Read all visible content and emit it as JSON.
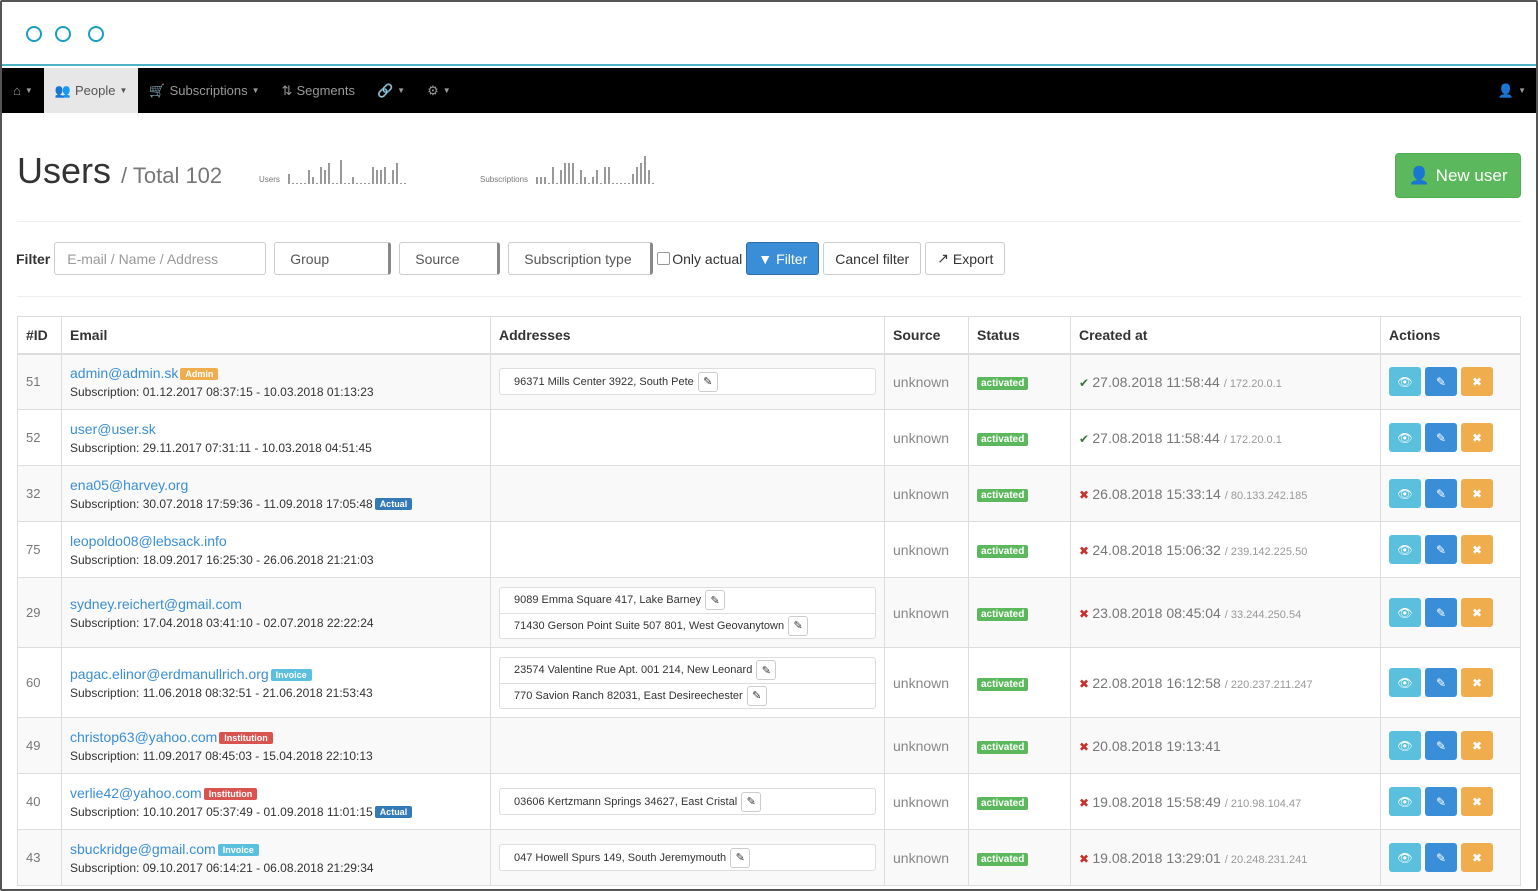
{
  "colors": {
    "accent": "#3a8ed8",
    "success": "#5cb85c",
    "info": "#5bc0de",
    "warning": "#f0ad4e",
    "danger": "#d9534f"
  },
  "nav": {
    "items": [
      {
        "icon": "home-icon",
        "label": ""
      },
      {
        "icon": "people-icon",
        "label": "People",
        "active": true
      },
      {
        "icon": "cart-icon",
        "label": "Subscriptions"
      },
      {
        "icon": "segments-icon",
        "label": "Segments"
      },
      {
        "icon": "link-icon",
        "label": ""
      },
      {
        "icon": "gear-icon",
        "label": ""
      }
    ],
    "user_icon": "user-icon"
  },
  "header": {
    "title": "Users",
    "subtitle": "/ Total 102",
    "new_user": "New user"
  },
  "sparklines": [
    {
      "label": "Users",
      "values": [
        3,
        0,
        0,
        0,
        0,
        4,
        2,
        0,
        5,
        4,
        6,
        0,
        0,
        7,
        0,
        0,
        2,
        0,
        0,
        0,
        0,
        5,
        4,
        4,
        5,
        0,
        4,
        6,
        0,
        0
      ]
    },
    {
      "label": "Subscriptions",
      "values": [
        2,
        2,
        2,
        0,
        5,
        0,
        4,
        6,
        6,
        6,
        0,
        4,
        2,
        0,
        2,
        4,
        0,
        5,
        5,
        0,
        0,
        0,
        0,
        0,
        3,
        5,
        6,
        8,
        4,
        0
      ]
    }
  ],
  "filter": {
    "label": "Filter",
    "search_placeholder": "E-mail / Name / Address",
    "group": "Group",
    "source": "Source",
    "subscription_type": "Subscription type",
    "only_actual": "Only actual",
    "filter_btn": "Filter",
    "cancel_btn": "Cancel filter",
    "export_btn": "Export"
  },
  "table": {
    "headers": [
      "#ID",
      "Email",
      "Addresses",
      "Source",
      "Status",
      "Created at",
      "Actions"
    ],
    "rows": [
      {
        "id": "51",
        "email": "admin@admin.sk",
        "labels": [
          {
            "text": "Admin",
            "color": "#f0ad4e"
          }
        ],
        "sub": "Subscription: 01.12.2017 08:37:15 - 10.03.2018 01:13:23",
        "sub_label": null,
        "addresses": [
          "96371 Mills Center 3922, South Pete"
        ],
        "source": "unknown",
        "status": "activated",
        "ok": true,
        "created": "27.08.2018 11:58:44",
        "ip": "/ 172.20.0.1"
      },
      {
        "id": "52",
        "email": "user@user.sk",
        "labels": [],
        "sub": "Subscription: 29.11.2017 07:31:11 - 10.03.2018 04:51:45",
        "sub_label": null,
        "addresses": [],
        "source": "unknown",
        "status": "activated",
        "ok": true,
        "created": "27.08.2018 11:58:44",
        "ip": "/ 172.20.0.1"
      },
      {
        "id": "32",
        "email": "ena05@harvey.org",
        "labels": [],
        "sub": "Subscription: 30.07.2018 17:59:36 - 11.09.2018 17:05:48",
        "sub_label": "Actual",
        "addresses": [],
        "source": "unknown",
        "status": "activated",
        "ok": false,
        "created": "26.08.2018 15:33:14",
        "ip": "/ 80.133.242.185"
      },
      {
        "id": "75",
        "email": "leopoldo08@lebsack.info",
        "labels": [],
        "sub": "Subscription: 18.09.2017 16:25:30 - 26.06.2018 21:21:03",
        "sub_label": null,
        "addresses": [],
        "source": "unknown",
        "status": "activated",
        "ok": false,
        "created": "24.08.2018 15:06:32",
        "ip": "/ 239.142.225.50"
      },
      {
        "id": "29",
        "email": "sydney.reichert@gmail.com",
        "labels": [],
        "sub": "Subscription: 17.04.2018 03:41:10 - 02.07.2018 22:22:24",
        "sub_label": null,
        "addresses": [
          "9089 Emma Square 417, Lake Barney",
          "71430 Gerson Point Suite 507 801, West Geovanytown"
        ],
        "source": "unknown",
        "status": "activated",
        "ok": false,
        "created": "23.08.2018 08:45:04",
        "ip": "/ 33.244.250.54"
      },
      {
        "id": "60",
        "email": "pagac.elinor@erdmanullrich.org",
        "labels": [
          {
            "text": "Invoice",
            "color": "#5bc0de"
          }
        ],
        "sub": "Subscription: 11.06.2018 08:32:51 - 21.06.2018 21:53:43",
        "sub_label": null,
        "addresses": [
          "23574 Valentine Rue Apt. 001 214, New Leonard",
          "770 Savion Ranch 82031, East Desireechester"
        ],
        "source": "unknown",
        "status": "activated",
        "ok": false,
        "created": "22.08.2018 16:12:58",
        "ip": "/ 220.237.211.247"
      },
      {
        "id": "49",
        "email": "christop63@yahoo.com",
        "labels": [
          {
            "text": "Institution",
            "color": "#d9534f"
          }
        ],
        "sub": "Subscription: 11.09.2017 08:45:03 - 15.04.2018 22:10:13",
        "sub_label": null,
        "addresses": [],
        "source": "unknown",
        "status": "activated",
        "ok": false,
        "created": "20.08.2018 19:13:41",
        "ip": ""
      },
      {
        "id": "40",
        "email": "verlie42@yahoo.com",
        "labels": [
          {
            "text": "Institution",
            "color": "#d9534f"
          }
        ],
        "sub": "Subscription: 10.10.2017 05:37:49 - 01.09.2018 11:01:15",
        "sub_label": "Actual",
        "addresses": [
          "03606 Kertzmann Springs 34627, East Cristal"
        ],
        "source": "unknown",
        "status": "activated",
        "ok": false,
        "created": "19.08.2018 15:58:49",
        "ip": "/ 210.98.104.47"
      },
      {
        "id": "43",
        "email": "sbuckridge@gmail.com",
        "labels": [
          {
            "text": "Invoice",
            "color": "#5bc0de"
          }
        ],
        "sub": "Subscription: 09.10.2017 06:14:21 - 06.08.2018 21:29:34",
        "sub_label": null,
        "addresses": [
          "047 Howell Spurs 149, South Jeremymouth"
        ],
        "source": "unknown",
        "status": "activated",
        "ok": false,
        "created": "19.08.2018 13:29:01",
        "ip": "/ 20.248.231.241"
      }
    ]
  }
}
